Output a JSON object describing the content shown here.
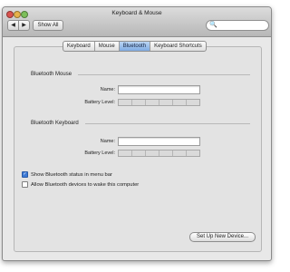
{
  "window": {
    "title": "Keyboard & Mouse"
  },
  "toolbar": {
    "back_symbol": "◀",
    "forward_symbol": "▶",
    "show_all_label": "Show All",
    "search_placeholder": "",
    "search_icon_symbol": "🔍"
  },
  "tabs": [
    {
      "label": "Keyboard",
      "selected": false
    },
    {
      "label": "Mouse",
      "selected": false
    },
    {
      "label": "Bluetooth",
      "selected": true
    },
    {
      "label": "Keyboard Shortcuts",
      "selected": false
    }
  ],
  "bluetooth_mouse": {
    "heading": "Bluetooth Mouse",
    "name_label": "Name:",
    "name_value": "",
    "battery_label": "Battery Level:"
  },
  "bluetooth_keyboard": {
    "heading": "Bluetooth Keyboard",
    "name_label": "Name:",
    "name_value": "",
    "battery_label": "Battery Level:"
  },
  "options": {
    "show_status": {
      "label": "Show Bluetooth status in menu bar",
      "checked": true,
      "check_symbol": "✓"
    },
    "allow_wake": {
      "label": "Allow Bluetooth devices to wake this computer",
      "checked": false
    }
  },
  "buttons": {
    "set_up_new_device": "Set Up New Device..."
  },
  "colors": {
    "accent": "#3d7ad6",
    "selected_tab": "#7fabe3",
    "window_bg": "#e8e8e8"
  }
}
